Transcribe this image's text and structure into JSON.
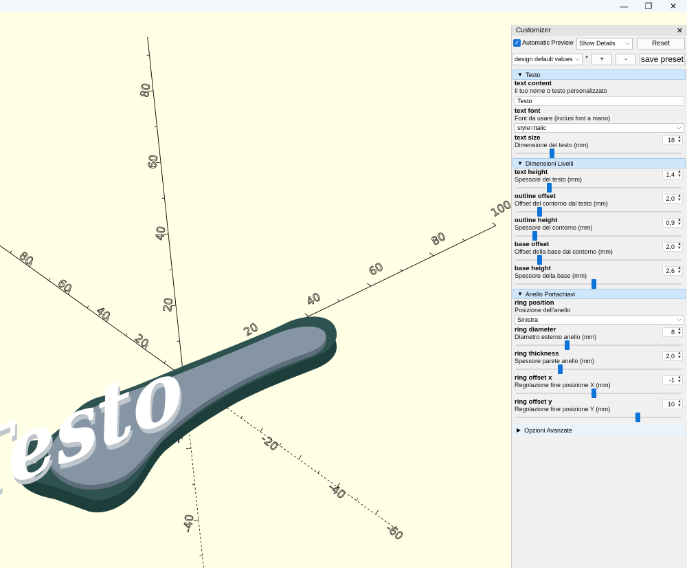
{
  "window": {
    "minimize_glyph": "—",
    "maximize_glyph": "❐",
    "close_glyph": "✕"
  },
  "viewport": {
    "axis_labels": [
      "20",
      "40",
      "60",
      "80",
      "100",
      "20",
      "40",
      "60",
      "80",
      "20",
      "40",
      "60",
      "80",
      "-20",
      "-40",
      "-60",
      "-20",
      "-40",
      "-20",
      "-40"
    ],
    "model_text": "Testo",
    "colors": {
      "background": "#ffffe5",
      "base": "#2e5250",
      "outline": "#8595a3",
      "text": "#ffffff"
    }
  },
  "customizer": {
    "title": "Customizer",
    "close_glyph": "✕",
    "automatic_preview_checked": true,
    "automatic_preview_label": "Automatic Preview",
    "details_select": "Show Details",
    "reset_label": "Reset",
    "preset_select": "design default values",
    "preset_modified_mark": "*",
    "add_label": "+",
    "remove_label": "-",
    "save_label": "save preset",
    "sections": [
      {
        "title": "Testo",
        "expanded": true,
        "params": [
          {
            "name": "text content",
            "desc": "Il tuo nome o testo personalizzato",
            "kind": "text",
            "value": "Testo"
          },
          {
            "name": "text font",
            "desc": "Font da usare (inclusi font a mano)",
            "kind": "combo",
            "value": "style=Italic"
          },
          {
            "name": "text size",
            "desc": "Dimensione del testo (mm)",
            "kind": "spin",
            "value": "18",
            "fraction": 0.21
          }
        ]
      },
      {
        "title": "Dimensioni Livelli",
        "expanded": true,
        "params": [
          {
            "name": "text height",
            "desc": "Spessore del testo (mm)",
            "kind": "spin",
            "value": "1,4",
            "fraction": 0.19
          },
          {
            "name": "outline offset",
            "desc": "Offset del contorno dal testo (mm)",
            "kind": "spin",
            "value": "2,0",
            "fraction": 0.13
          },
          {
            "name": "outline height",
            "desc": "Spessore del contorno (mm)",
            "kind": "spin",
            "value": "0,9",
            "fraction": 0.1
          },
          {
            "name": "base offset",
            "desc": "Offset della base dal contorno (mm)",
            "kind": "spin",
            "value": "2,0",
            "fraction": 0.13
          },
          {
            "name": "base height",
            "desc": "Spessore della base (mm)",
            "kind": "spin",
            "value": "2,6",
            "fraction": 0.47
          }
        ]
      },
      {
        "title": "Anello Portachiavi",
        "expanded": true,
        "params": [
          {
            "name": "ring position",
            "desc": "Posizione dell'anello",
            "kind": "combo",
            "value": "Sinistra"
          },
          {
            "name": "ring diameter",
            "desc": "Diametro esterno anello (mm)",
            "kind": "spin",
            "value": "8",
            "fraction": 0.3
          },
          {
            "name": "ring thickness",
            "desc": "Spessore parete anello (mm)",
            "kind": "spin",
            "value": "2,0",
            "fraction": 0.26
          },
          {
            "name": "ring offset x",
            "desc": "Regolazione fine posizione X (mm)",
            "kind": "spin",
            "value": "-1",
            "fraction": 0.47
          },
          {
            "name": "ring offset y",
            "desc": "Regolazione fine posizione Y (mm)",
            "kind": "spin",
            "value": "10",
            "fraction": 0.74
          }
        ]
      }
    ],
    "advanced_title": "Opzioni Avanzate"
  }
}
